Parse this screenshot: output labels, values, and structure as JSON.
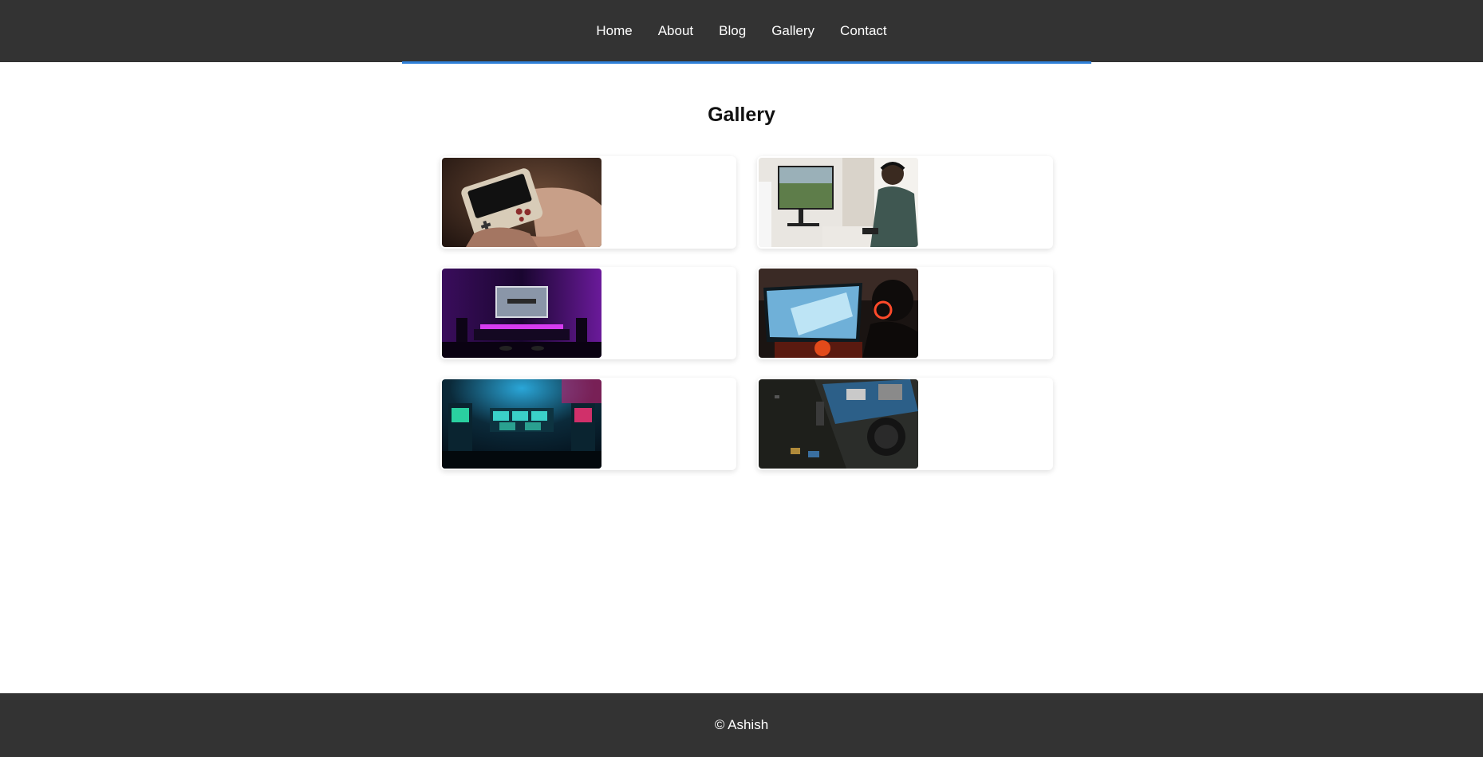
{
  "nav": {
    "items": [
      {
        "label": "Home"
      },
      {
        "label": "About"
      },
      {
        "label": "Blog"
      },
      {
        "label": "Gallery"
      },
      {
        "label": "Contact"
      }
    ],
    "accent_color": "#2f80d8",
    "background": "#333333"
  },
  "page": {
    "title": "Gallery"
  },
  "gallery": {
    "items": [
      {
        "subject": "handheld-console"
      },
      {
        "subject": "gamer-at-monitor"
      },
      {
        "subject": "purple-tv-setup"
      },
      {
        "subject": "gamer-red-headset"
      },
      {
        "subject": "neon-game-room"
      },
      {
        "subject": "laptop-internals"
      }
    ]
  },
  "footer": {
    "text": "© Ashish"
  }
}
